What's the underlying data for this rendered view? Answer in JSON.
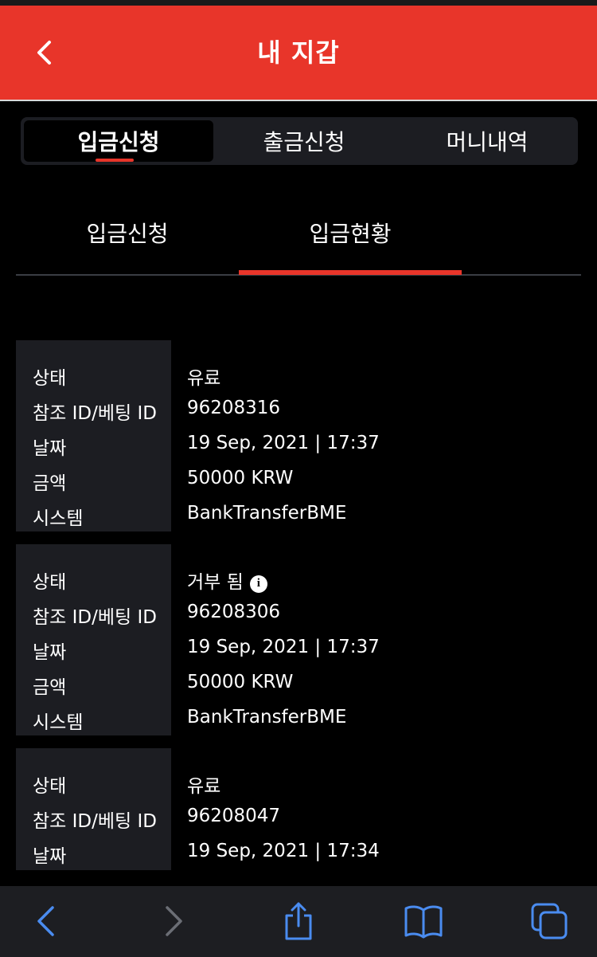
{
  "header": {
    "title": "내 지갑",
    "back_icon": "chevron-left-icon",
    "background": "#e8352a"
  },
  "segment": {
    "tabs": [
      {
        "label": "입금신청",
        "active": true
      },
      {
        "label": "출금신청",
        "active": false
      },
      {
        "label": "머니내역",
        "active": false
      }
    ]
  },
  "subtabs": {
    "items": [
      {
        "label": "입금신청",
        "active": false
      },
      {
        "label": "입금현황",
        "active": true
      }
    ]
  },
  "labels": {
    "status": "상태",
    "ref_id": "참조 ID/베팅 ID",
    "date": "날짜",
    "amount": "금액",
    "system": "시스템"
  },
  "records": [
    {
      "status": "유료",
      "ref_id": "96208316",
      "date": "19 Sep, 2021 | 17:37",
      "amount": "50000 KRW",
      "system": "BankTransferBME",
      "has_info": false
    },
    {
      "status": "거부 됨",
      "ref_id": "96208306",
      "date": "19 Sep, 2021 | 17:37",
      "amount": "50000 KRW",
      "system": "BankTransferBME",
      "has_info": true
    },
    {
      "status": "유료",
      "ref_id": "96208047",
      "date": "19 Sep, 2021 | 17:34",
      "amount": "",
      "system": "",
      "has_info": false
    }
  ],
  "browser_bar": {
    "icons": [
      "back-icon",
      "forward-icon",
      "share-icon",
      "bookmarks-icon",
      "tabs-icon"
    ],
    "accent": "#4a8cf0",
    "disabled": "#6b6e75"
  }
}
